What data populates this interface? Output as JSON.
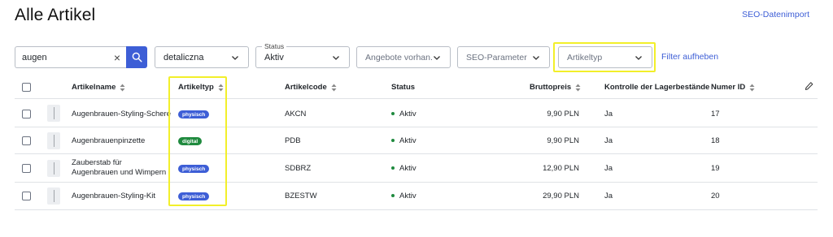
{
  "page": {
    "title": "Alle Artikel",
    "seo_import": "SEO-Datenimport"
  },
  "filters": {
    "search_value": "augen",
    "clear_icon": "×",
    "category_select": "detaliczna",
    "status_label": "Status",
    "status_value": "Aktiv",
    "offers_placeholder": "Angebote vorhan...",
    "seo_placeholder": "SEO-Parameter",
    "artikeltyp_placeholder": "Artikeltyp",
    "reset": "Filter aufheben"
  },
  "columns": {
    "name": "Artikelname",
    "type": "Artikeltyp",
    "code": "Artikelcode",
    "status": "Status",
    "price": "Bruttopreis",
    "stock": "Kontrolle der Lagerbestände",
    "id": "Numer ID"
  },
  "rows": [
    {
      "name": "Augenbrauen-Styling-Schere",
      "type": "physisch",
      "code": "AKCN",
      "status": "Aktiv",
      "price": "9,90 PLN",
      "stock": "Ja",
      "id": "17"
    },
    {
      "name": "Augenbrauenpinzette",
      "type": "digital",
      "code": "PDB",
      "status": "Aktiv",
      "price": "9,90 PLN",
      "stock": "Ja",
      "id": "18"
    },
    {
      "name": "Zauberstab für Augenbrauen und Wimpern",
      "type": "physisch",
      "code": "SDBRZ",
      "status": "Aktiv",
      "price": "12,90 PLN",
      "stock": "Ja",
      "id": "19"
    },
    {
      "name": "Augenbrauen-Styling-Kit",
      "type": "physisch",
      "code": "BZESTW",
      "status": "Aktiv",
      "price": "29,90 PLN",
      "stock": "Ja",
      "id": "20"
    }
  ],
  "colors": {
    "accent": "#3d5ed6",
    "status_green": "#1f8a3e",
    "badge_digital": "#1f8a3e",
    "highlight": "#f2ef2a"
  },
  "icons": [
    "search-icon",
    "close-icon",
    "chevron-down-icon",
    "sort-icon",
    "pencil-icon"
  ]
}
